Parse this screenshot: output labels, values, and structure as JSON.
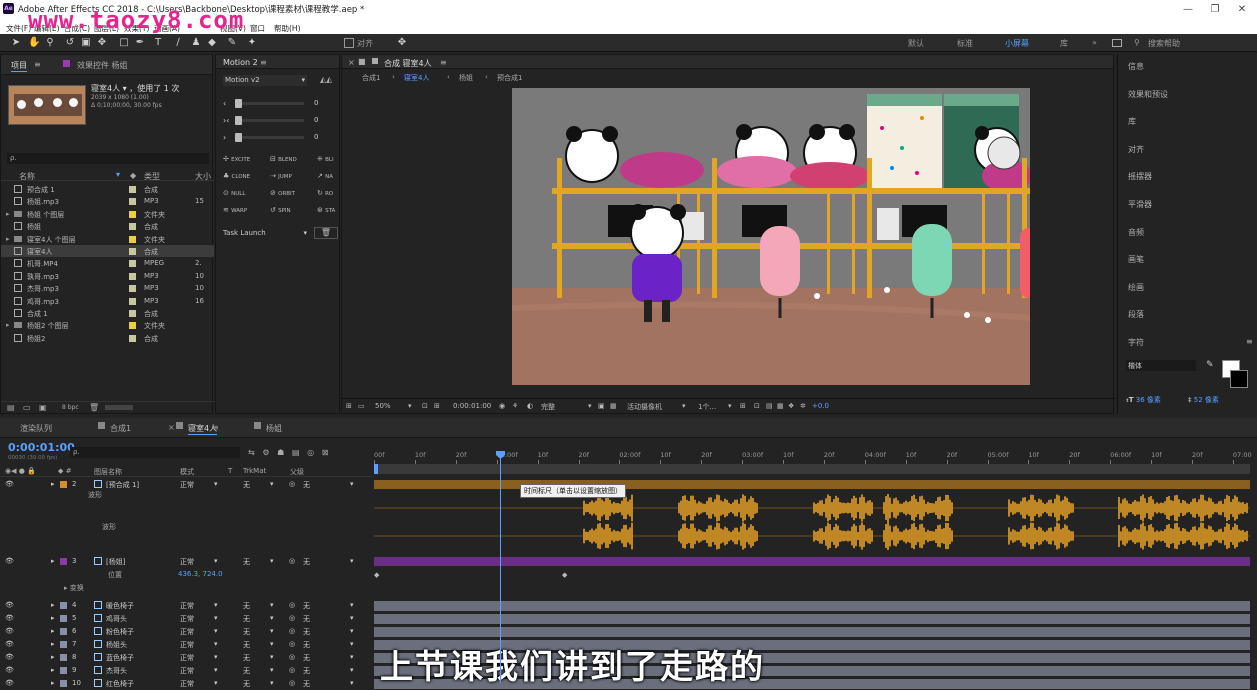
{
  "titlebar": {
    "title": "Adobe After Effects CC 2018 - C:\\Users\\Backbone\\Desktop\\课程素材\\课程教学.aep *",
    "ae_badge": "Ae"
  },
  "menubar": {
    "items": [
      "文件(F)",
      "编辑(E)",
      "合成(C)",
      "图层(L)",
      "效果(T)",
      "动画(A)",
      "视图(V)",
      "窗口",
      "帮助(H)"
    ]
  },
  "watermark": "www.taozy8.com",
  "toolbar": {
    "snap_label": "对齐",
    "workspaces": [
      "默认",
      "标准",
      "小屏幕",
      "库"
    ],
    "active_workspace": "小屏幕",
    "search_placeholder": "搜索帮助"
  },
  "project": {
    "tab_label": "项目",
    "effects_tab": "效果控件 杨姐",
    "comp_name": "寝室4人",
    "comp_used": "使用了 1 次",
    "comp_meta1": "2039 x 1080 (1.00)",
    "comp_meta2": "Δ 0;10;00;00, 30.00 fps",
    "search_placeholder": "ρ.",
    "col_name": "名称",
    "col_type": "类型",
    "col_size": "大小",
    "items": [
      {
        "name": "预合成 1",
        "type": "合成",
        "color": "#c8c8a0",
        "size": ""
      },
      {
        "name": "杨姐.mp3",
        "type": "MP3",
        "color": "#c8c8a0",
        "size": "15"
      },
      {
        "name": "杨姐 个图层",
        "type": "文件夹",
        "color": "#e8d040",
        "size": ""
      },
      {
        "name": "杨姐",
        "type": "合成",
        "color": "#c8c8a0",
        "size": ""
      },
      {
        "name": "寝室4人 个图层",
        "type": "文件夹",
        "color": "#e8d040",
        "size": ""
      },
      {
        "name": "寝室4人",
        "type": "合成",
        "color": "#c8c8a0",
        "size": ""
      },
      {
        "name": "机哥.MP4",
        "type": "MPEG",
        "color": "#c8c8a0",
        "size": "2."
      },
      {
        "name": "孰哥.mp3",
        "type": "MP3",
        "color": "#c8c8a0",
        "size": "10"
      },
      {
        "name": "杰哥.mp3",
        "type": "MP3",
        "color": "#c8c8a0",
        "size": "10"
      },
      {
        "name": "鸡哥.mp3",
        "type": "MP3",
        "color": "#c8c8a0",
        "size": "16"
      },
      {
        "name": "合成 1",
        "type": "合成",
        "color": "#c8c8a0",
        "size": ""
      },
      {
        "name": "杨姐2 个图层",
        "type": "文件夹",
        "color": "#e8d040",
        "size": ""
      },
      {
        "name": "杨姐2",
        "type": "合成",
        "color": "#c8c8a0",
        "size": ""
      }
    ],
    "bpc": "8 bpc"
  },
  "motion": {
    "tab_label": "Motion 2",
    "preset": "Motion v2",
    "sliders": [
      {
        "label": "‹",
        "value": "0"
      },
      {
        "label": "›‹",
        "value": "0"
      },
      {
        "label": "›",
        "value": "0"
      }
    ],
    "buttons": [
      "EXCITE",
      "BLEND",
      "BLI",
      "CLONE",
      "JUMP",
      "NA",
      "NULL",
      "ORBIT",
      "RO",
      "WARP",
      "SPIN",
      "STA"
    ],
    "task": "Task Launch"
  },
  "comp_panel": {
    "title": "合成 寝室4人",
    "breadcrumbs": [
      "合成1",
      "寝室4人",
      "杨姐",
      "预合成1"
    ],
    "zoom": "50%",
    "timecode": "0:00:01:00",
    "quality": "完整",
    "camera": "活动摄像机",
    "views": "1个...",
    "exposure": "+0.0"
  },
  "right_panel": {
    "items": [
      "信息",
      "效果和预设",
      "库",
      "对齐",
      "摇摆器",
      "平滑器",
      "音频",
      "画笔",
      "绘画",
      "段落",
      "字符"
    ],
    "font": "楷体",
    "font_size": "36 像素",
    "leading": "52 像素"
  },
  "timeline": {
    "tabs": [
      "渲染队列",
      "合成1",
      "寝室4人",
      "杨姐"
    ],
    "active_tab": "寝室4人",
    "timecode": "0:00:01:00",
    "frame": "00030 (30.00 fps)",
    "col_source": "图层名称",
    "col_mode": "模式",
    "col_trkmat": "TrkMat",
    "col_parent": "父级",
    "ruler": [
      "00f",
      "10f",
      "20f",
      "01:00f",
      "10f",
      "20f",
      "02:00f",
      "10f",
      "20f",
      "03:00f",
      "10f",
      "20f",
      "04:00f",
      "10f",
      "20f",
      "05:00f",
      "10f",
      "20f",
      "06:00f",
      "10f",
      "20f",
      "07:00"
    ],
    "tooltip": "时间标尺（单击以设置缩放图）",
    "waveform_label": "波形",
    "layers": [
      {
        "num": "2",
        "name": "[预合成 1]",
        "mode": "正常",
        "trk": "无",
        "parent": "无",
        "color": "#d88c2c"
      },
      {
        "num": "3",
        "name": "[杨姐]",
        "mode": "正常",
        "trk": "无",
        "parent": "无",
        "color": "#8a3aa0"
      },
      {
        "num": "4",
        "name": "暖色椅子",
        "mode": "正常",
        "trk": "无",
        "parent": "无",
        "color": "#8890a8"
      },
      {
        "num": "5",
        "name": "鸡哥头",
        "mode": "正常",
        "trk": "无",
        "parent": "无",
        "color": "#8890a8"
      },
      {
        "num": "6",
        "name": "粉色椅子",
        "mode": "正常",
        "trk": "无",
        "parent": "无",
        "color": "#8890a8"
      },
      {
        "num": "7",
        "name": "杨姐头",
        "mode": "正常",
        "trk": "无",
        "parent": "无",
        "color": "#8890a8"
      },
      {
        "num": "8",
        "name": "蓝色椅子",
        "mode": "正常",
        "trk": "无",
        "parent": "无",
        "color": "#8890a8"
      },
      {
        "num": "9",
        "name": "杰哥头",
        "mode": "正常",
        "trk": "无",
        "parent": "无",
        "color": "#8890a8"
      },
      {
        "num": "10",
        "name": "红色椅子",
        "mode": "正常",
        "trk": "无",
        "parent": "无",
        "color": "#8890a8"
      }
    ],
    "position_label": "位置",
    "position_value": "436.3, 724.0",
    "effects_label": "变换"
  },
  "subtitle": "上节课我们讲到了走路的"
}
